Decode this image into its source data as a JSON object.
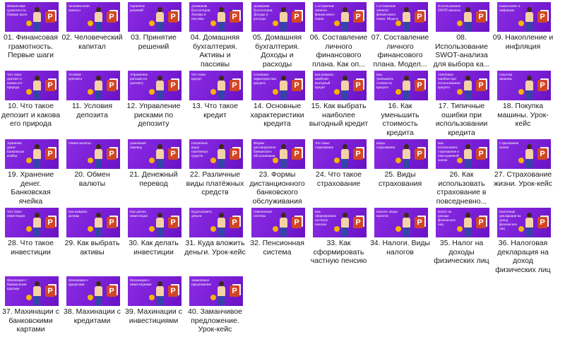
{
  "files": [
    {
      "thumb_title": "Финансовая грамотность. Первые шаги",
      "label": "01. Финансовая грамотность. Первые шаги"
    },
    {
      "thumb_title": "Человеческий капитал",
      "label": "02. Человеческий капитал"
    },
    {
      "thumb_title": "Принятие решений",
      "label": "03. Принятие решений"
    },
    {
      "thumb_title": "Домашняя бухгалтерия. Активы и пассивы",
      "label": "04. Домашняя бухгалтерия. Активы и пассивы"
    },
    {
      "thumb_title": "Домашняя бухгалтерия. Доходы и расходы",
      "label": "05. Домашняя бухгалтерия. Доходы и расходы"
    },
    {
      "thumb_title": "Составление личного финансового плана",
      "label": "06. Составление личного финансового плана. Как оп..."
    },
    {
      "thumb_title": "Составление личного финансового плана. Модель",
      "label": "07. Составление личного финансового плана. Модел..."
    },
    {
      "thumb_title": "Использование SWOT-анализа",
      "label": "08. Использование SWOT-анализа для выбора ка..."
    },
    {
      "thumb_title": "Накопление и инфляция",
      "label": "09. Накопление и инфляция"
    },
    {
      "thumb_title": "Что такое депозит и какова его природа",
      "label": "10. Что такое депозит и какова его природа"
    },
    {
      "thumb_title": "Условия депозита",
      "label": "11. Условия депозита"
    },
    {
      "thumb_title": "Управление рисками по депозиту",
      "label": "12. Управление рисками по депозиту"
    },
    {
      "thumb_title": "Что такое кредит",
      "label": "13. Что такое кредит"
    },
    {
      "thumb_title": "Основные характеристики кредита",
      "label": "14. Основные характеристики кредита"
    },
    {
      "thumb_title": "Как выбрать наиболее выгодный кредит",
      "label": "15. Как выбрать наиболее выгодный кредит"
    },
    {
      "thumb_title": "Как уменьшить стоимость кредита",
      "label": "16. Как уменьшить стоимость кредита"
    },
    {
      "thumb_title": "Типичные ошибки при использовании кредита",
      "label": "17. Типичные ошибки при использовании кредита"
    },
    {
      "thumb_title": "Покупка машины",
      "label": "18. Покупка машины. Урок-кейс"
    },
    {
      "thumb_title": "Хранение денег. Банковская ячейка",
      "label": "19. Хранение денег. Банковская ячейка"
    },
    {
      "thumb_title": "Обмен валюты",
      "label": "20. Обмен валюты"
    },
    {
      "thumb_title": "Денежный перевод",
      "label": "21. Денежный перевод"
    },
    {
      "thumb_title": "Различные виды платёжных средств",
      "label": "22. Различные виды платёжных средств"
    },
    {
      "thumb_title": "Формы дистанционного банковского обслуживания",
      "label": "23. Формы дистанционного банковского обслуживания"
    },
    {
      "thumb_title": "Что такое страхование",
      "label": "24. Что такое страхование"
    },
    {
      "thumb_title": "Виды страхования",
      "label": "25. Виды страхования"
    },
    {
      "thumb_title": "Как использовать страхование в повседневной жизни",
      "label": "26. Как использовать страхование в повседневно..."
    },
    {
      "thumb_title": "Страхование жизни",
      "label": "27. Страхование жизни. Урок-кейс"
    },
    {
      "thumb_title": "Что такое инвестиции",
      "label": "28. Что такое инвестиции"
    },
    {
      "thumb_title": "Как выбрать активы",
      "label": "29. Как выбрать активы"
    },
    {
      "thumb_title": "Как делать инвестиции",
      "label": "30. Как делать инвестиции"
    },
    {
      "thumb_title": "Куда вложить деньги",
      "label": "31. Куда вложить деньги. Урок-кейс"
    },
    {
      "thumb_title": "Пенсионная система",
      "label": "32. Пенсионная система"
    },
    {
      "thumb_title": "Как сформировать частную пенсию",
      "label": "33. Как сформировать частную пенсию"
    },
    {
      "thumb_title": "Налоги. Виды налогов",
      "label": "34. Налоги. Виды налогов"
    },
    {
      "thumb_title": "Налог на доходы физических лиц",
      "label": "35. Налог на доходы физических лиц"
    },
    {
      "thumb_title": "Налоговая декларация на доход физических лиц",
      "label": "36. Налоговая декларация на доход физических лиц"
    },
    {
      "thumb_title": "Махинации с банковскими картами",
      "label": "37. Махинации с банковскими картами"
    },
    {
      "thumb_title": "Махинации с кредитами",
      "label": "38. Махинации с кредитами"
    },
    {
      "thumb_title": "Махинации с инвестициями",
      "label": "39. Махинации с инвестициями"
    },
    {
      "thumb_title": "Заманчивое предложение",
      "label": "40. Заманчивое предложение. Урок-кейс"
    }
  ]
}
